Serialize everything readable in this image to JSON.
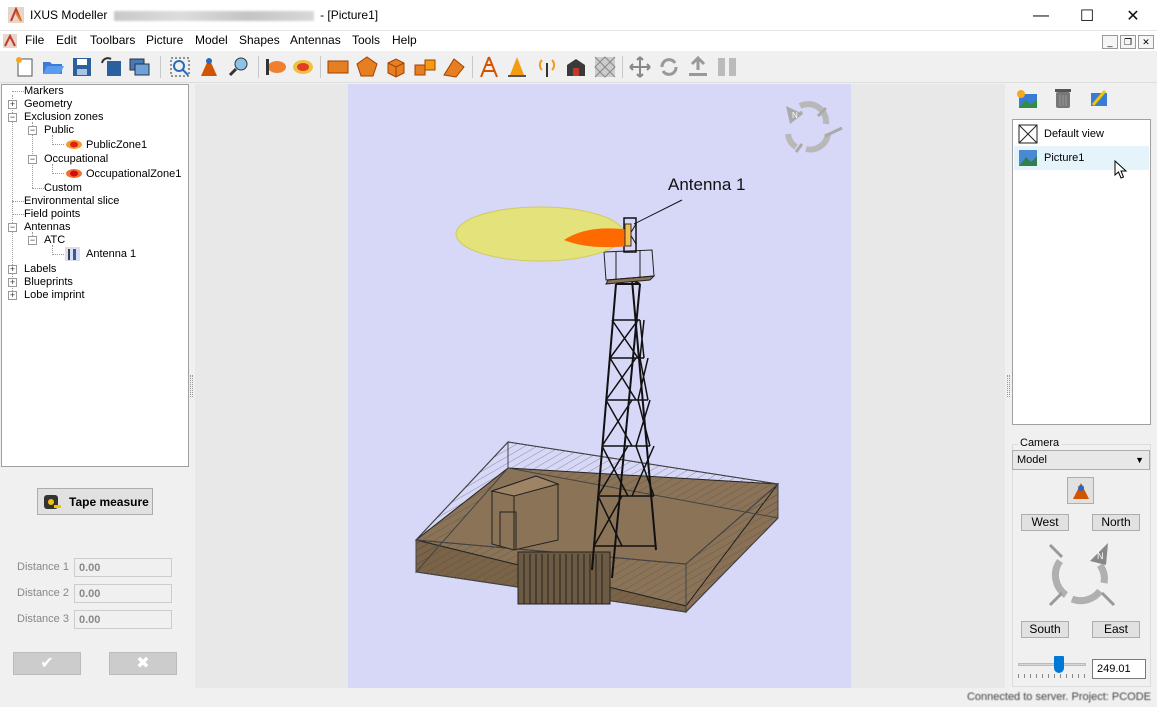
{
  "window": {
    "app_name": "IXUS Modeller",
    "doc_title": "- [Picture1]",
    "minimize_glyph": "—",
    "maximize_glyph": "☐",
    "close_glyph": "✕"
  },
  "menu": {
    "items": [
      "File",
      "Edit",
      "Toolbars",
      "Picture",
      "Model",
      "Shapes",
      "Antennas",
      "Tools",
      "Help"
    ]
  },
  "mdi": {
    "minimize": "_",
    "restore": "❐",
    "close": "✕"
  },
  "toolbar": {
    "icons": [
      "new-doc-icon",
      "open-folder-icon",
      "save-icon",
      "undo-save-icon",
      "windows-icon",
      "zoom-select-icon",
      "antenna-place-icon",
      "view-zoom-icon",
      "beam-icon",
      "exclusion-icon",
      "rectangle-icon",
      "pentagon-icon",
      "box-icon",
      "multi-box-icon",
      "roof-icon",
      "tower-icon",
      "cone-icon",
      "signal-icon",
      "building-icon",
      "grid-icon",
      "move-icon",
      "rotate-icon",
      "upload-icon",
      "split-icon"
    ]
  },
  "tree": {
    "markers": "Markers",
    "geometry": "Geometry",
    "exclusion_zones": "Exclusion zones",
    "public": "Public",
    "public_zone": "PublicZone1",
    "occupational": "Occupational",
    "occupational_zone": "OccupationalZone1",
    "custom": "Custom",
    "environmental_slice": "Environmental slice",
    "field_points": "Field points",
    "antennas": "Antennas",
    "atc": "ATC",
    "antenna1": "Antenna 1",
    "labels": "Labels",
    "blueprints": "Blueprints",
    "lobe_imprint": "Lobe imprint"
  },
  "tape": {
    "button_label": "Tape measure",
    "distances": [
      {
        "label": "Distance 1",
        "value": "0.00"
      },
      {
        "label": "Distance 2",
        "value": "0.00"
      },
      {
        "label": "Distance 3",
        "value": "0.00"
      }
    ],
    "ok_glyph": "✔",
    "cancel_glyph": "✖"
  },
  "scene": {
    "antenna_label": "Antenna 1",
    "compass_letter": "N"
  },
  "views": {
    "items": [
      "Default view",
      "Picture1"
    ],
    "selected": "Picture1"
  },
  "camera": {
    "group_label": "Camera",
    "mode": "Model",
    "west": "West",
    "north": "North",
    "south": "South",
    "east": "East",
    "compass_letter": "N",
    "zoom_value": "249.01",
    "slider_fraction": 0.62
  },
  "status": {
    "text": "Connected to server. Project: PCODE"
  },
  "colors": {
    "canvas": "#d7d7f8",
    "ground": "#8b7358",
    "lobe_public": "#e4e27a",
    "lobe_occupational": "#ff6a00"
  }
}
